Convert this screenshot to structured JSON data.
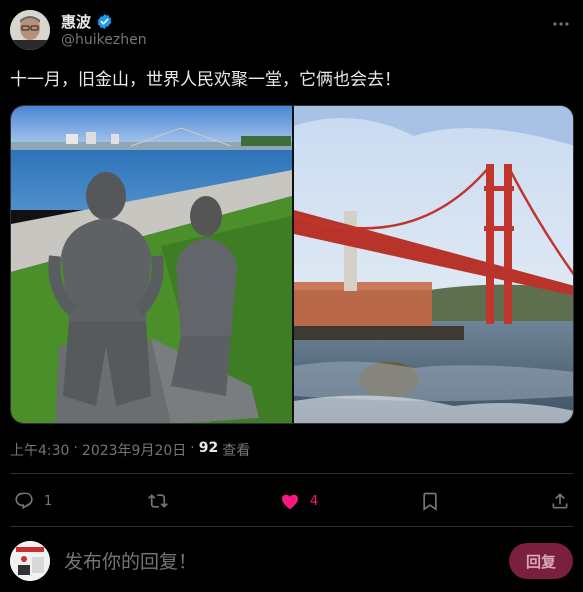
{
  "author": {
    "display_name": "惠波",
    "handle": "@huikezhen",
    "verified": true
  },
  "tweet": {
    "text": "十一月，旧金山，世界人民欢聚一堂，它俩也会去！",
    "time": "上午4:30",
    "date": "2023年9月20日",
    "separator": "·",
    "views_count": "92",
    "views_label": "查看"
  },
  "media": {
    "images": [
      {
        "icon": "statue-photo"
      },
      {
        "icon": "golden-gate-bridge-photo"
      }
    ]
  },
  "actions": {
    "reply_count": "1",
    "retweet_count": "",
    "like_count": "4",
    "liked": true,
    "like_color": "#f91880"
  },
  "reply": {
    "placeholder": "发布你的回复！",
    "button_label": "回复"
  },
  "colors": {
    "background": "#000000",
    "text": "#e7e9ea",
    "secondary": "#71767b",
    "verified": "#1d9bf0",
    "reply_button": "#7a1f3d"
  }
}
